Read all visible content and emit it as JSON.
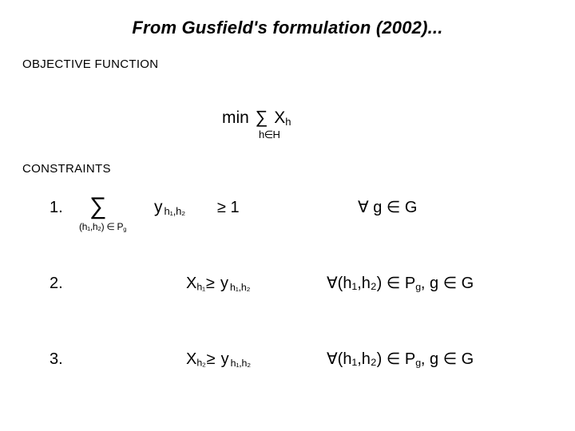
{
  "slide": {
    "title": "From Gusfield's formulation (2002)...",
    "background_color": "#ffffff",
    "text_color": "#000000"
  },
  "objective": {
    "heading": "OBJECTIVE FUNCTION",
    "min_label": "min",
    "sigma": "∑",
    "variable": "X",
    "variable_subscript": "h",
    "sum_limit": "h∈H",
    "full_text": "min ∑ X_h  (h∈H)"
  },
  "constraints": {
    "heading": "CONSTRAINTS",
    "items": [
      {
        "index": "1.",
        "sigma": "∑",
        "sum_limit": "(h₁,h₂) ∈ Pɢ",
        "sum_limit_base": "(h",
        "variable": "y",
        "variable_subscript": "h₁,h₂",
        "relation": "≥ 1",
        "qualifier": "∀ g ∈ G",
        "full_text": "1.  ∑_{(h₁,h₂) ∈ P_g} y_{h₁,h₂} ≥ 1      ∀ g ∈ G"
      },
      {
        "index": "2.",
        "lhs_variable": "X",
        "lhs_subscript": "h₁",
        "relation": "≥",
        "rhs_variable": "y",
        "rhs_subscript": "h₁,h₂",
        "qualifier": "∀(h₁,h₂) ∈ Pɢ ,  g ∈ G",
        "full_text": "2.  X_{h₁} ≥ y_{h₁,h₂}      ∀(h₁,h₂) ∈ P_g , g ∈ G"
      },
      {
        "index": "3.",
        "lhs_variable": "X",
        "lhs_subscript": "h₂",
        "relation": "≥",
        "rhs_variable": "y",
        "rhs_subscript": "h₁,h₂",
        "qualifier": "∀(h₁,h₂) ∈ Pɢ ,  g ∈ G",
        "full_text": "3.  X_{h₂} ≥ y_{h₁,h₂}      ∀(h₁,h₂) ∈ P_g , g ∈ G"
      }
    ]
  },
  "symbols": {
    "sigma": "∑",
    "forall": "∀",
    "element_of": "∈",
    "greater_equal": "≥"
  },
  "parts": {
    "obj_min": "min",
    "obj_sigma": "∑",
    "obj_var": "X",
    "obj_var_sub": "h",
    "obj_limit": "h∈H",
    "c1_sigma": "∑",
    "c1_limit": "(h₁,h₂) ∈ P",
    "c1_limit_sub": "g",
    "c1_var": "y",
    "c1_var_sub": "h₁,h₂",
    "c1_rel": "≥ 1",
    "c1_qual_head": "∀ g ∈ G",
    "c2_index": "2.",
    "c2_lhs": "X",
    "c2_lhs_sub": "h₁",
    "c2_rel": "≥",
    "c2_rhs": "y",
    "c2_rhs_sub": "h₁,h₂",
    "c2_qual": "∀(h₁,h₂) ∈ P",
    "c2_qual_sub": "g",
    "c2_qual_tail": ",  g ∈ G",
    "c3_index": "3.",
    "c3_lhs": "X",
    "c3_lhs_sub": "h₂",
    "c3_rel": "≥",
    "c3_rhs": "y",
    "c3_rhs_sub": "h₁,h₂",
    "c3_qual": "∀(h₁,h₂) ∈ P",
    "c3_qual_sub": "g",
    "c3_qual_tail": ",  g ∈ G",
    "c1_index": "1."
  }
}
